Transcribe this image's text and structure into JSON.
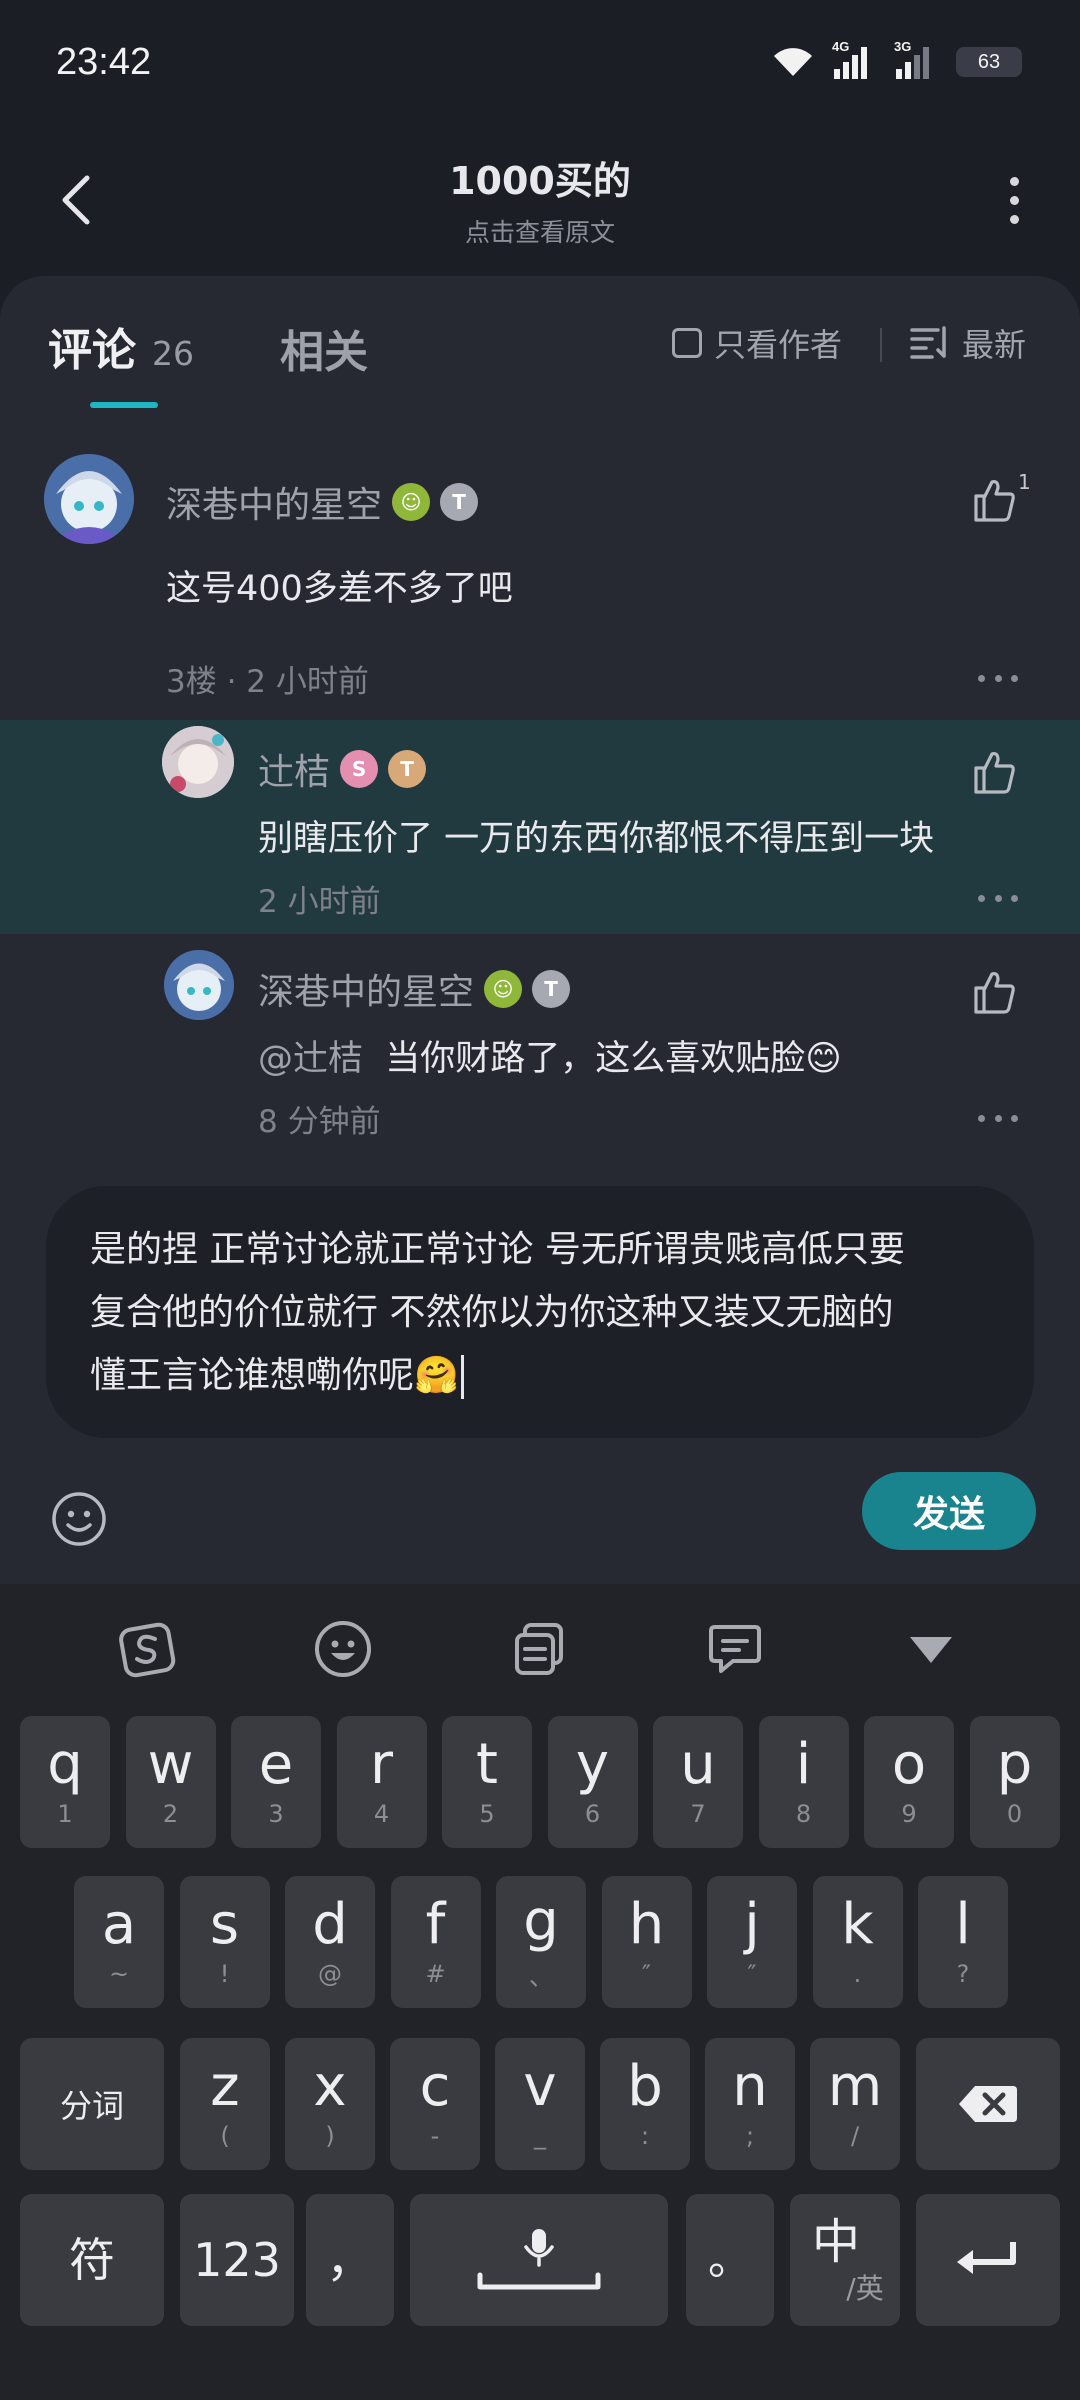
{
  "status": {
    "time": "23:42",
    "net1": "4G",
    "net2": "3G",
    "battery": "63"
  },
  "header": {
    "title": "1000买的",
    "subtitle": "点击查看原文"
  },
  "tabs": {
    "comments_label": "评论",
    "comments_count": "26",
    "related_label": "相关",
    "author_only": "只看作者",
    "sort": "最新"
  },
  "comments": [
    {
      "user": "深巷中的星空",
      "text": "这号400多差不多了吧",
      "meta": "3楼 · 2 小时前",
      "likes": "1"
    },
    {
      "user": "辻桔",
      "text": "别瞎压价了 一万的东西你都恨不得压到一块",
      "meta": "2 小时前"
    },
    {
      "user": "深巷中的星空",
      "mention": "@辻桔",
      "text": "当你财路了，这么喜欢贴脸😊",
      "meta": "8 分钟前"
    }
  ],
  "composer": {
    "lines": [
      "是的捏 正常讨论就正常讨论 号无所谓贵贱高低只要",
      "复合他的价位就行 不然你以为你这种又装又无脑的",
      "懂王言论谁想嘞你呢🤗"
    ],
    "send_label": "发送"
  },
  "keyboard": {
    "row1": [
      {
        "k": "q",
        "s": "1"
      },
      {
        "k": "w",
        "s": "2"
      },
      {
        "k": "e",
        "s": "3"
      },
      {
        "k": "r",
        "s": "4"
      },
      {
        "k": "t",
        "s": "5"
      },
      {
        "k": "y",
        "s": "6"
      },
      {
        "k": "u",
        "s": "7"
      },
      {
        "k": "i",
        "s": "8"
      },
      {
        "k": "o",
        "s": "9"
      },
      {
        "k": "p",
        "s": "0"
      }
    ],
    "row2": [
      {
        "k": "a",
        "s": "~"
      },
      {
        "k": "s",
        "s": "!"
      },
      {
        "k": "d",
        "s": "@"
      },
      {
        "k": "f",
        "s": "#"
      },
      {
        "k": "g",
        "s": "、"
      },
      {
        "k": "h",
        "s": "″"
      },
      {
        "k": "j",
        "s": "″"
      },
      {
        "k": "k",
        "s": "."
      },
      {
        "k": "l",
        "s": "?"
      }
    ],
    "row3": [
      {
        "k": "z",
        "s": "("
      },
      {
        "k": "x",
        "s": ")"
      },
      {
        "k": "c",
        "s": "-"
      },
      {
        "k": "v",
        "s": "_"
      },
      {
        "k": "b",
        "s": ":"
      },
      {
        "k": "n",
        "s": ";"
      },
      {
        "k": "m",
        "s": "/"
      }
    ],
    "split_label": "分词",
    "symbol_label": "符",
    "num_label": "123",
    "comma": "，",
    "period": "。",
    "lang_main": "中",
    "lang_sub": "/英"
  }
}
